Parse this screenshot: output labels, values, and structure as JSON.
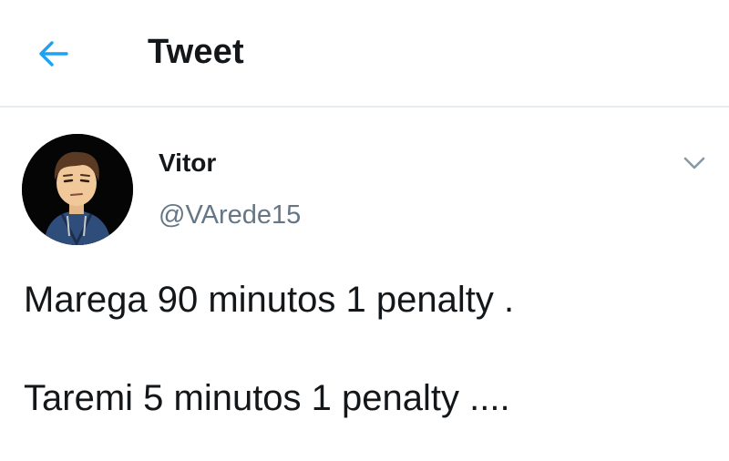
{
  "header": {
    "title": "Tweet",
    "back_icon": "arrow-left-icon",
    "accent_color": "#1da1f2"
  },
  "author": {
    "display_name": "Vitor",
    "handle": "@VArede15",
    "avatar": "cartoon-avatar"
  },
  "menu": {
    "icon": "chevron-down-icon"
  },
  "tweet": {
    "lines": [
      "Marega 90 minutos 1 penalty .",
      "Taremi 5 minutos 1 penalty ...."
    ]
  }
}
